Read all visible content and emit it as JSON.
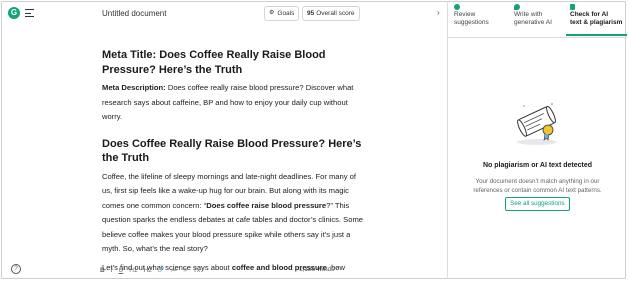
{
  "app": {
    "logo_letter": "G",
    "document_title": "Untitled document",
    "goals_label": "Goals",
    "score_value": "95",
    "score_label": "Overall score",
    "help_symbol": "?",
    "collapse_symbol": "›"
  },
  "document": {
    "meta_title": "Meta Title: Does Coffee Really Raise Blood Pressure? Here’s the Truth",
    "meta_description_label": "Meta Description:",
    "meta_description_text": " Does coffee really raise blood pressure? Discover what research says about caffeine, BP and how to enjoy your daily cup without worry.",
    "heading": "Does Coffee Really Raise Blood Pressure? Here’s the Truth",
    "para1": "Coffee, the lifeline of sleepy mornings and late-night deadlines. For many of us, first sip feels like a wake-up hug for our brain. But along with its magic comes one common concern: “",
    "para1_bold": "Does coffee raise blood pressure",
    "para1_tail": "?” This question sparks the endless debates at cafe tables and doctor’s clinics. Some believe coffee makes your blood pressure spike while others say it’s just a myth. So, what’s the real story?",
    "para2": "Let’s find out what science says about ",
    "para2_bold": "coffee and blood pressure",
    "para2_tail": ", how"
  },
  "toolbar": {
    "bold": "B",
    "italic": "I",
    "underline": "U",
    "h1": "H1",
    "h2": "H2",
    "link": "🔗",
    "ol": "≔",
    "ul": "≡",
    "clear": "Tx",
    "word_count": "1,186 words",
    "word_count_toggle": "^"
  },
  "panel": {
    "tabs": [
      {
        "label_line1": "Review",
        "label_line2": "suggestions"
      },
      {
        "label_line1": "Write with",
        "label_line2": "generative AI"
      },
      {
        "label_line1": "Check for AI",
        "label_line2": "text & plagiarism"
      }
    ],
    "result_title": "No plagiarism or AI text detected",
    "result_description": "Your document doesn’t match anything in our references or contain common AI text patterns.",
    "see_all_label": "See all suggestions"
  },
  "colors": {
    "accent": "#12a37a"
  }
}
